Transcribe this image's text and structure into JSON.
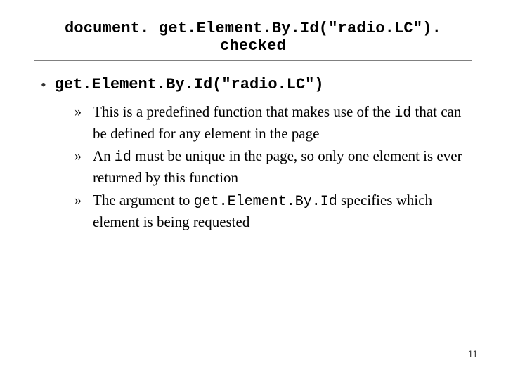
{
  "title": "document. get.Element.By.Id(\"radio.LC\"). checked",
  "bullet": {
    "marker": "•",
    "code": "get.Element.By.Id(\"radio.LC\")"
  },
  "subbullet_marker": "»",
  "sub": [
    {
      "pre": "This is a predefined function that makes use of the ",
      "code": "id",
      "post": " that can be defined for any element in the page"
    },
    {
      "pre": "An ",
      "code": "id",
      "post": " must be unique in the page, so only one element is ever returned by this function"
    },
    {
      "pre": "The argument to ",
      "code": "get.Element.By.Id",
      "post": " specifies which element is being requested"
    }
  ],
  "page_number": "11"
}
